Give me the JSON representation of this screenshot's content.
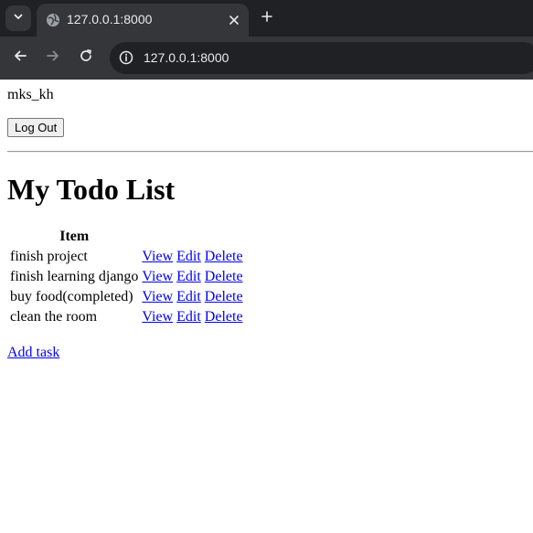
{
  "browser": {
    "tab": {
      "title": "127.0.0.1:8000"
    },
    "address_bar": {
      "url": "127.0.0.1:8000"
    },
    "icons": {
      "tab_search": "chevron-down-icon",
      "favicon": "globe-icon",
      "close": "close-icon",
      "new_tab": "plus-icon",
      "back": "arrow-left-icon",
      "forward": "arrow-right-icon",
      "reload": "reload-icon",
      "site_info": "info-icon"
    },
    "colors": {
      "frame": "#202124",
      "toolbar": "#35363a",
      "text": "#e8eaed"
    }
  },
  "page": {
    "username": "mks_kh",
    "logout_label": "Log Out",
    "title": "My Todo List",
    "table": {
      "header": "Item",
      "rows": [
        {
          "item": "finish project",
          "view": "View",
          "edit": "Edit",
          "delete": "Delete"
        },
        {
          "item": "finish learning django",
          "view": "View",
          "edit": "Edit",
          "delete": "Delete"
        },
        {
          "item": "buy food(completed)",
          "view": "View",
          "edit": "Edit",
          "delete": "Delete"
        },
        {
          "item": "clean the room",
          "view": "View",
          "edit": "Edit",
          "delete": "Delete"
        }
      ]
    },
    "add_task_label": "Add task",
    "colors": {
      "link": "#0000ee",
      "text": "#000000"
    }
  }
}
